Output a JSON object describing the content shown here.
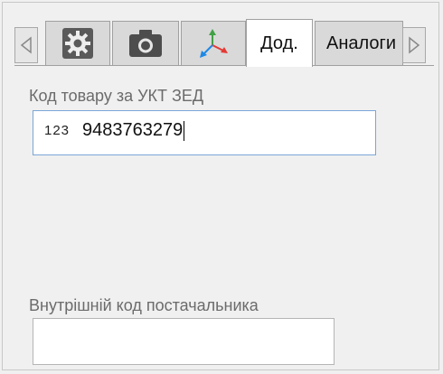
{
  "tabs": [
    {
      "id": "settings",
      "icon": "gear-icon"
    },
    {
      "id": "photo",
      "icon": "camera-icon"
    },
    {
      "id": "axes",
      "icon": "axes-icon"
    },
    {
      "id": "extra",
      "label": "Дод."
    },
    {
      "id": "analogs",
      "label": "Аналоги"
    }
  ],
  "active_tab": "extra",
  "fields": {
    "customs_code": {
      "label": "Код товару за УКТ ЗЕД",
      "prefix": "123",
      "value": "9483763279"
    },
    "supplier_code": {
      "label": "Внутрішній код постачальника",
      "value": ""
    }
  },
  "colors": {
    "axis_x": "#e53935",
    "axis_y": "#43a047",
    "axis_z": "#1e88e5",
    "focus_border": "#7aa6d6"
  }
}
